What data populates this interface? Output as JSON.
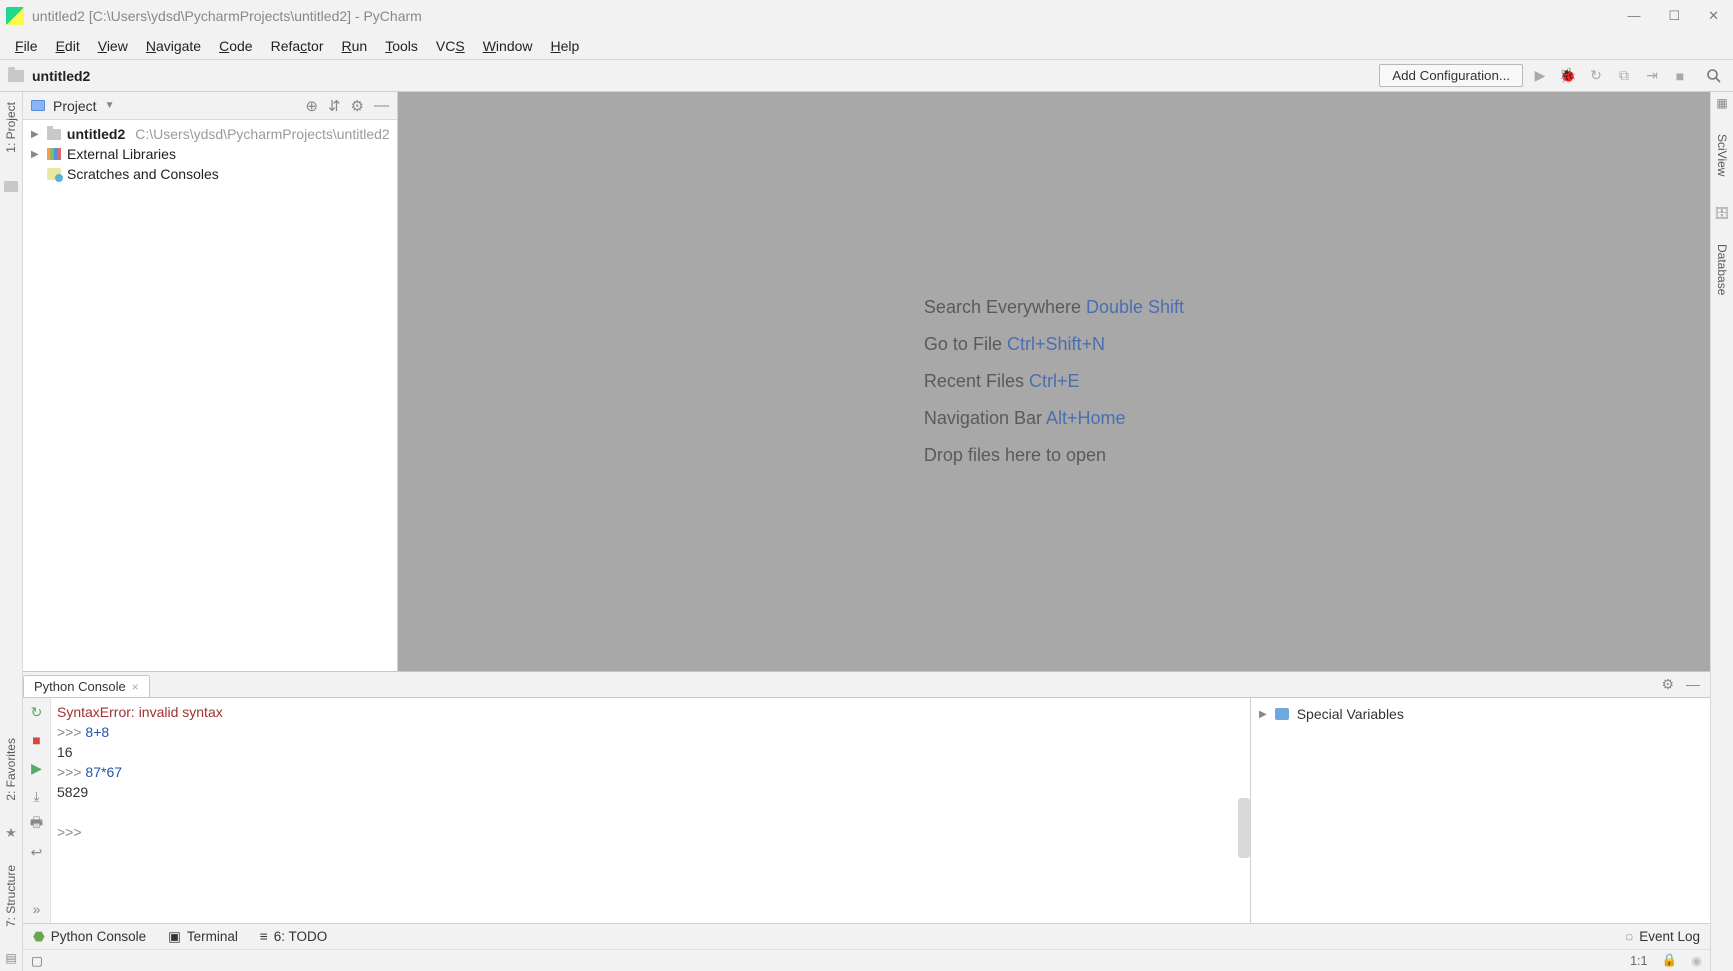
{
  "title": "untitled2 [C:\\Users\\ydsd\\PycharmProjects\\untitled2] - PyCharm",
  "menu": [
    "File",
    "Edit",
    "View",
    "Navigate",
    "Code",
    "Refactor",
    "Run",
    "Tools",
    "VCS",
    "Window",
    "Help"
  ],
  "menu_underline_idx": [
    0,
    0,
    0,
    0,
    0,
    4,
    0,
    0,
    2,
    0,
    0
  ],
  "breadcrumb": {
    "label": "untitled2"
  },
  "add_config": "Add Configuration...",
  "left_tabs": {
    "project": "1: Project",
    "favorites": "2: Favorites",
    "structure": "7: Structure"
  },
  "right_tabs": {
    "sciview": "SciView",
    "database": "Database"
  },
  "project_panel": {
    "title": "Project",
    "root": {
      "name": "untitled2",
      "path": "C:\\Users\\ydsd\\PycharmProjects\\untitled2"
    },
    "external_libs": "External Libraries",
    "scratches": "Scratches and Consoles"
  },
  "tips": [
    {
      "label": "Search Everywhere",
      "shortcut": "Double Shift"
    },
    {
      "label": "Go to File",
      "shortcut": "Ctrl+Shift+N"
    },
    {
      "label": "Recent Files",
      "shortcut": "Ctrl+E"
    },
    {
      "label": "Navigation Bar",
      "shortcut": "Alt+Home"
    }
  ],
  "drop_text": "Drop files here to open",
  "console_tab": "Python Console",
  "console_lines": [
    {
      "type": "err",
      "text": "SyntaxError: invalid syntax"
    },
    {
      "type": "in",
      "prompt": ">>> ",
      "a": "8",
      "op": "+",
      "b": "8"
    },
    {
      "type": "out",
      "text": "16"
    },
    {
      "type": "in",
      "prompt": ">>> ",
      "a": "87",
      "op": "*",
      "b": "67"
    },
    {
      "type": "out",
      "text": "5829"
    },
    {
      "type": "blank"
    },
    {
      "type": "prompt_only",
      "prompt": ">>> "
    }
  ],
  "vars": {
    "special": "Special Variables"
  },
  "bottom_tools": {
    "console": "Python Console",
    "terminal": "Terminal",
    "todo": "6: TODO",
    "eventlog": "Event Log"
  },
  "status": {
    "line_col": "1:1"
  }
}
